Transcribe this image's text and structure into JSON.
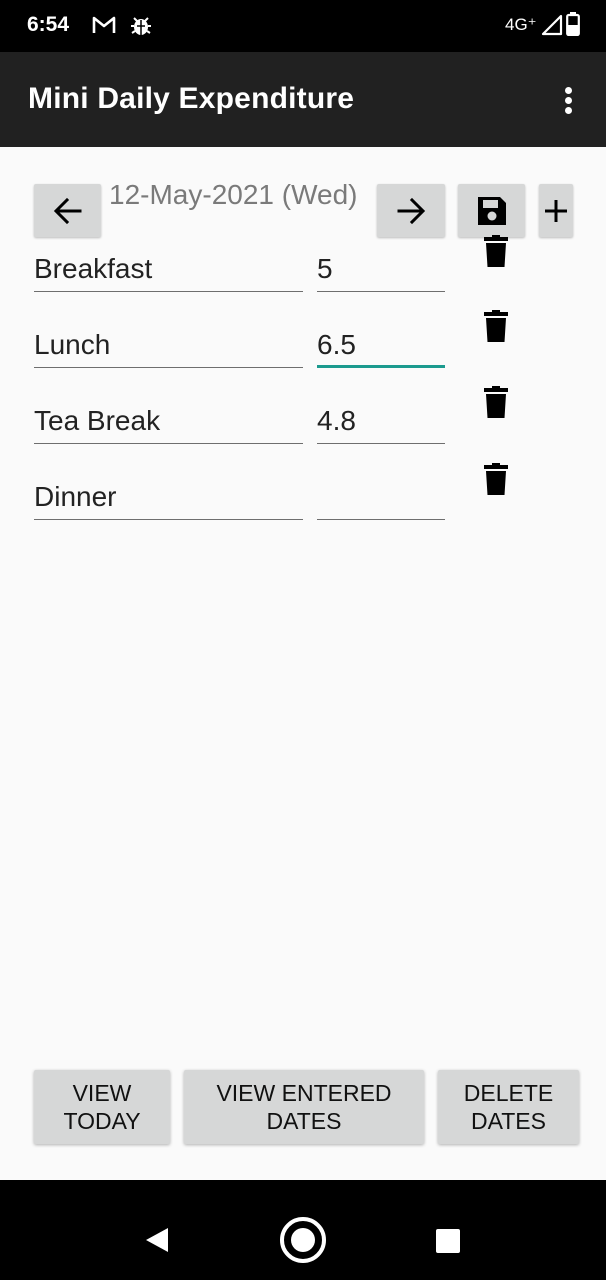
{
  "status_bar": {
    "time": "6:54",
    "network": "4G⁺",
    "icons": [
      "gmail-icon",
      "bug-icon",
      "signal-icon",
      "battery-icon"
    ]
  },
  "app_bar": {
    "title": "Mini Daily Expenditure",
    "icons": [
      "more-vert-icon"
    ]
  },
  "date_nav": {
    "date": "12-May-2021 (Wed)",
    "icons": [
      "arrow-left-icon",
      "arrow-right-icon",
      "save-icon",
      "plus-icon"
    ]
  },
  "expenses": [
    {
      "name": "Breakfast",
      "amount": "5"
    },
    {
      "name": "Lunch",
      "amount": "6.5"
    },
    {
      "name": "Tea Break",
      "amount": "4.8"
    },
    {
      "name": "Dinner",
      "amount": ""
    }
  ],
  "buttons": {
    "view_today": "VIEW\nTODAY",
    "view_entered_dates": "VIEW ENTERED\nDATES",
    "delete_dates": "DELETE\nDATES"
  },
  "system_nav": {
    "icons": [
      "back-icon",
      "home-icon",
      "recents-icon"
    ]
  },
  "colors": {
    "app_bar": "#212121",
    "accent": "#1b9a8e",
    "button": "#d6d7d7",
    "background": "#fafafa"
  }
}
